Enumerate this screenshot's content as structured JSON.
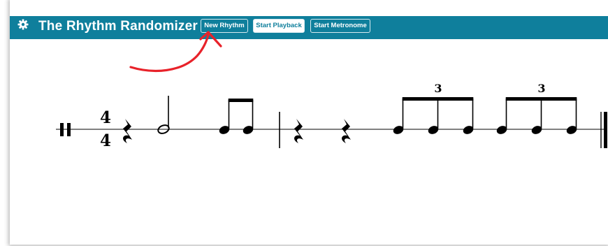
{
  "app": {
    "title": "The Rhythm Randomizer"
  },
  "toolbar": {
    "new_rhythm_label": "New Rhythm",
    "start_playback_label": "Start Playback",
    "start_metronome_label": "Start Metronome"
  },
  "score": {
    "time_signature": {
      "numerator": "4",
      "denominator": "4"
    },
    "tuplets": [
      "3",
      "3"
    ],
    "measures": [
      {
        "notes": [
          "quarter rest",
          "half note",
          "eighth note",
          "eighth note"
        ]
      },
      {
        "notes": [
          "quarter rest",
          "quarter rest",
          "eighth-note triplet",
          "eighth-note triplet"
        ]
      }
    ]
  },
  "colors": {
    "toolbar_bg": "#0f7f9c",
    "annotation_arrow": "#e8222a",
    "notation": "#000000"
  },
  "icons": [
    "gear-icon"
  ]
}
